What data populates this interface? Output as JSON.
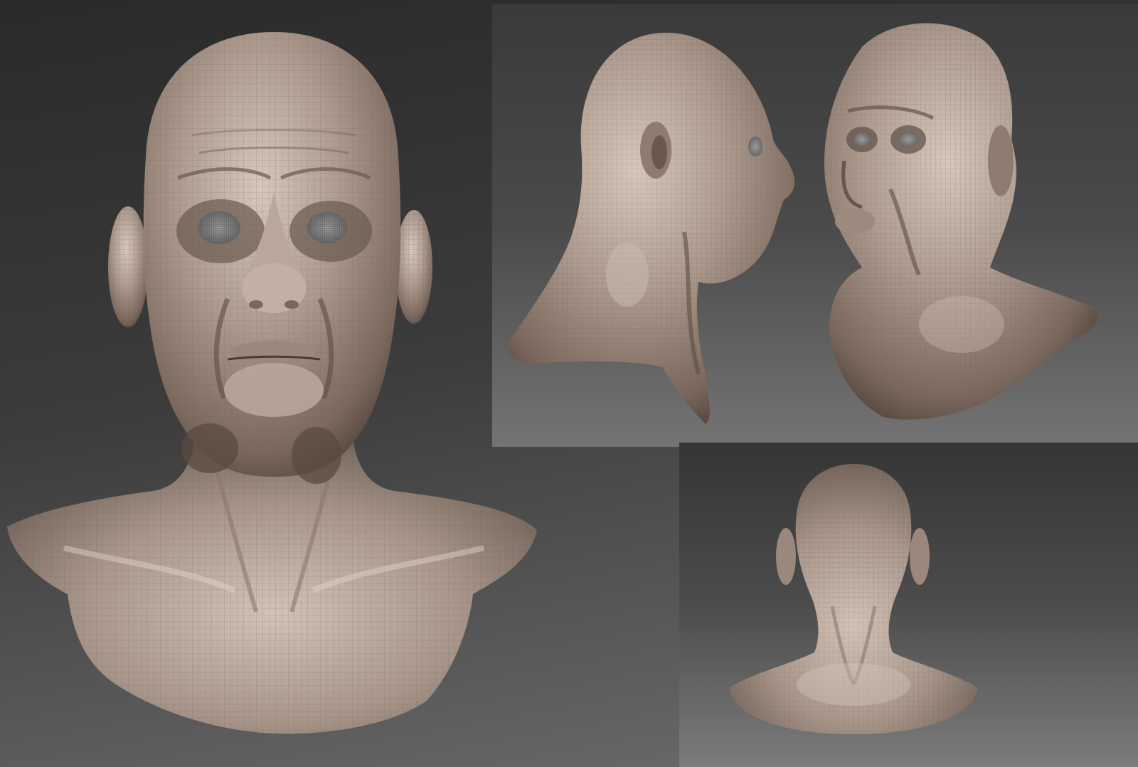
{
  "scene": {
    "subject": "sculpted-bust",
    "views": [
      {
        "id": "front",
        "label": ""
      },
      {
        "id": "right-profile",
        "label": ""
      },
      {
        "id": "three-quarter-left",
        "label": ""
      },
      {
        "id": "back",
        "label": ""
      }
    ],
    "colors": {
      "skin": "#a8968a",
      "skin_light": "#cdbcb0",
      "skin_dark": "#5a4a40",
      "wire": "#7d6c62",
      "bg_dark": "#2a2a2a",
      "bg_light": "#7a7a7a"
    }
  }
}
